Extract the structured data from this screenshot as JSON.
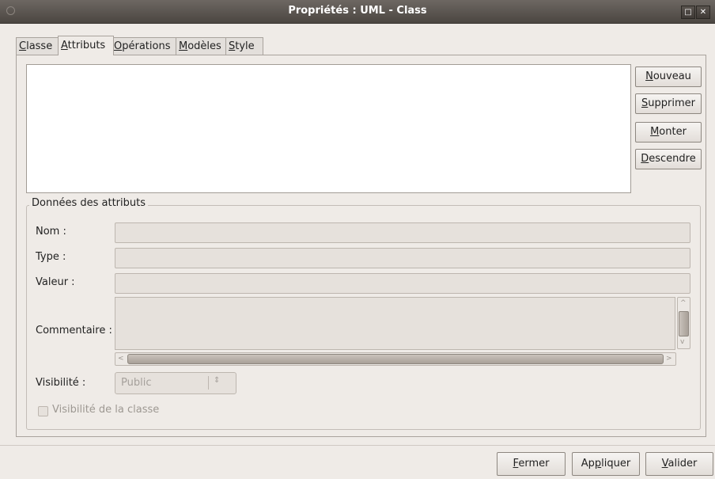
{
  "window": {
    "title": "Propriétés : UML - Class"
  },
  "tabs": [
    {
      "label": "Classe",
      "mnemonic": "C",
      "rest": "lasse"
    },
    {
      "label": "Attributs",
      "mnemonic": "A",
      "rest": "ttributs"
    },
    {
      "label": "Opérations",
      "mnemonic": "O",
      "rest": "pérations"
    },
    {
      "label": "Modèles",
      "mnemonic": "M",
      "rest": "odèles"
    },
    {
      "label": "Style",
      "mnemonic": "S",
      "rest": "tyle"
    }
  ],
  "side_buttons": {
    "nouveau": {
      "mnemonic": "N",
      "rest": "ouveau"
    },
    "supprimer": {
      "mnemonic": "S",
      "rest": "upprimer"
    },
    "monter": {
      "mnemonic": "M",
      "rest": "onter"
    },
    "descendre": {
      "mnemonic": "D",
      "rest": "escendre"
    }
  },
  "attribute_data": {
    "legend": "Données des attributs",
    "name_label": "Nom :",
    "type_label": "Type :",
    "value_label": "Valeur :",
    "comment_label": "Commentaire :",
    "visibility_label": "Visibilité :",
    "visibility_value": "Public",
    "class_visibility_label": "Visibilité de la classe"
  },
  "footer": {
    "fermer": {
      "mnemonic": "F",
      "rest": "ermer"
    },
    "appliquer": {
      "pre": "Ap",
      "mnemonic": "p",
      "rest": "liquer"
    },
    "valider": {
      "mnemonic": "V",
      "rest": "alider"
    }
  }
}
